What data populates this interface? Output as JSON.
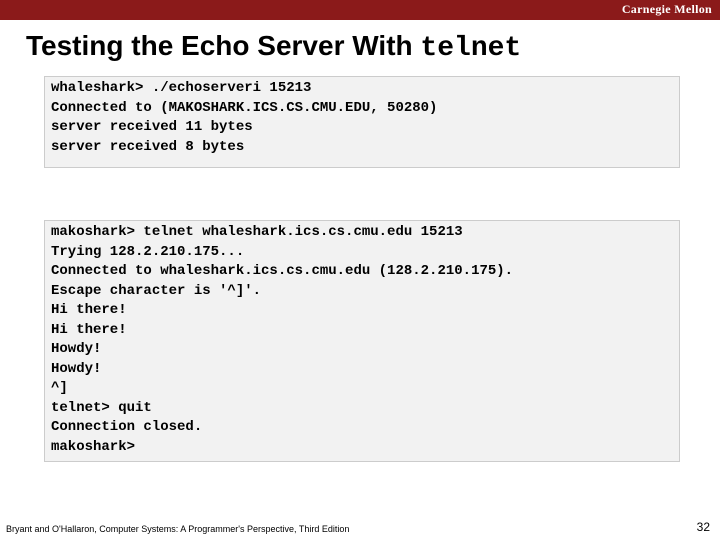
{
  "header": {
    "brand": "Carnegie Mellon"
  },
  "title": {
    "prefix": "Testing the Echo Server With ",
    "mono": "telnet"
  },
  "code1": {
    "l0": "whaleshark> ./echoserveri 15213",
    "l1": "Connected to (MAKOSHARK.ICS.CS.CMU.EDU, 50280)",
    "l2": "server received 11 bytes",
    "l3": "server received 8 bytes"
  },
  "code2": {
    "l0": "makoshark> telnet whaleshark.ics.cs.cmu.edu 15213",
    "l1": "Trying 128.2.210.175...",
    "l2": "Connected to whaleshark.ics.cs.cmu.edu (128.2.210.175).",
    "l3": "Escape character is '^]'.",
    "l4": "Hi there!",
    "l5": "Hi there!",
    "l6": "Howdy!",
    "l7": "Howdy!",
    "l8": "^]",
    "l9": "telnet> quit",
    "l10": "Connection closed.",
    "l11": "makoshark>"
  },
  "footer": {
    "left": "Bryant and O'Hallaron, Computer Systems: A Programmer's Perspective, Third Edition",
    "page": "32"
  }
}
